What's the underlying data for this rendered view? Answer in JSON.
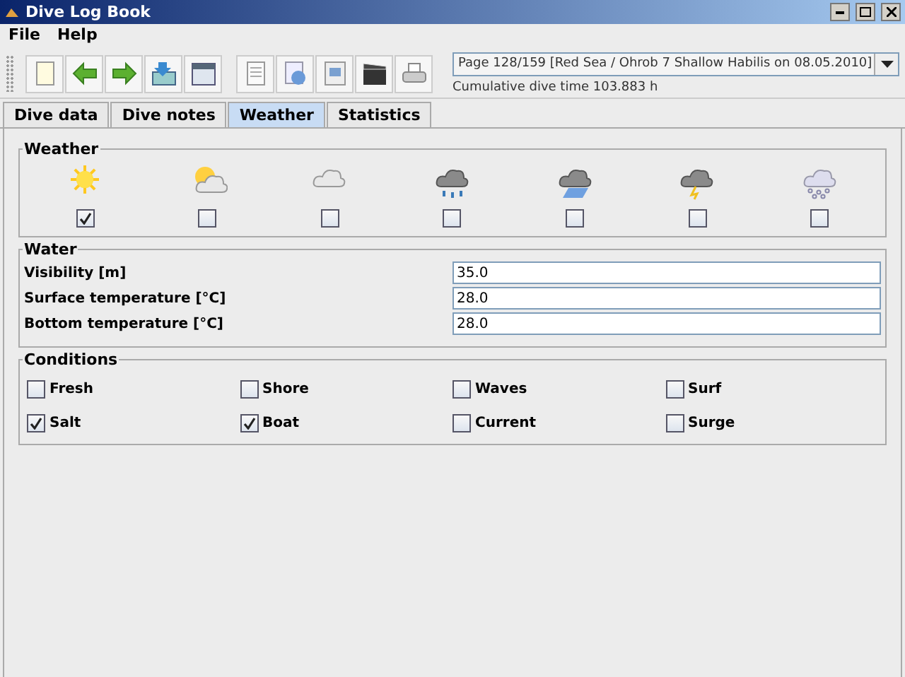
{
  "window": {
    "title": "Dive Log Book"
  },
  "menu": [
    "File",
    "Help"
  ],
  "page_selector": {
    "value": "Page 128/159 [Red Sea / Ohrob 7 Shallow Habilis on 08.05.2010]"
  },
  "cumulative": "Cumulative dive time 103.883 h",
  "tabs": [
    {
      "label": "Dive data",
      "selected": false
    },
    {
      "label": "Dive notes",
      "selected": false
    },
    {
      "label": "Weather",
      "selected": true
    },
    {
      "label": "Statistics",
      "selected": false
    }
  ],
  "weather": {
    "title": "Weather",
    "items": [
      {
        "kind": "sunny",
        "checked": true
      },
      {
        "kind": "partly",
        "checked": false
      },
      {
        "kind": "cloudy",
        "checked": false
      },
      {
        "kind": "rain",
        "checked": false
      },
      {
        "kind": "sleet",
        "checked": false
      },
      {
        "kind": "storm",
        "checked": false
      },
      {
        "kind": "snow",
        "checked": false
      }
    ]
  },
  "water": {
    "title": "Water",
    "fields": [
      {
        "label": "Visibility [m]",
        "value": "35.0"
      },
      {
        "label": "Surface temperature [°C]",
        "value": "28.0"
      },
      {
        "label": "Bottom temperature [°C]",
        "value": "28.0"
      }
    ]
  },
  "conditions": {
    "title": "Conditions",
    "items": [
      {
        "label": "Fresh",
        "checked": false
      },
      {
        "label": "Shore",
        "checked": false
      },
      {
        "label": "Waves",
        "checked": false
      },
      {
        "label": "Surf",
        "checked": false
      },
      {
        "label": "Salt",
        "checked": true
      },
      {
        "label": "Boat",
        "checked": true
      },
      {
        "label": "Current",
        "checked": false
      },
      {
        "label": "Surge",
        "checked": false
      }
    ]
  }
}
